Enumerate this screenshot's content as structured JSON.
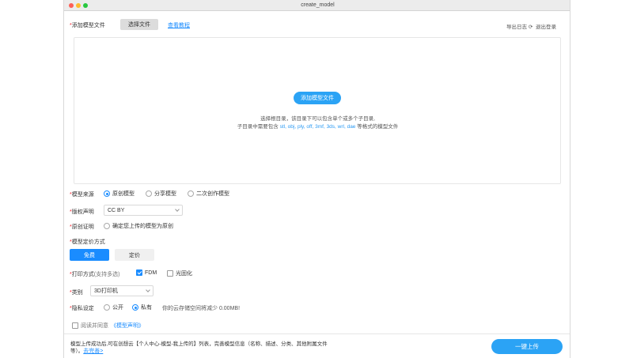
{
  "window": {
    "title": "create_model"
  },
  "header": {
    "add_file_label": "添加模型文件",
    "select_file_button": "选择文件",
    "tutorial_link": "查看教程",
    "export_log": "导出日志",
    "logout": "退出登录"
  },
  "dropzone": {
    "add_button": "添加模型文件",
    "hint_line1": "选择根目录，该目录下可以包含单个或多个子目录,",
    "hint_line2_prefix": "子目录中需要包含",
    "hint_formats": "stl, obj, ply, off, 3mf, 3ds, wrl, dae",
    "hint_line2_suffix": "等格式的模型文件"
  },
  "form": {
    "source": {
      "label": "模型来源",
      "options": [
        "原创模型",
        "分享模型",
        "二次创作模型"
      ],
      "selected": "原创模型"
    },
    "license": {
      "label": "版权声明",
      "value": "CC BY"
    },
    "original_proof": {
      "label": "原创证明",
      "option": "确定您上传的模型为原创"
    },
    "pricing": {
      "label": "模型定价方式",
      "options": [
        "免费",
        "定价"
      ],
      "selected": "免费"
    },
    "print_method": {
      "label": "打印方式",
      "note": "(支持多选)",
      "options": [
        {
          "label": "FDM",
          "checked": true
        },
        {
          "label": "光固化",
          "checked": false
        }
      ]
    },
    "category": {
      "label": "类别",
      "value": "3D打印机"
    },
    "privacy": {
      "label": "隐私设定",
      "options": [
        "公开",
        "私有"
      ],
      "selected": "私有",
      "note": "你的云存储空间将减少 0.00MB!"
    },
    "agreement": {
      "prefix": "阅读并同意",
      "link": "《模型声明》"
    }
  },
  "footer": {
    "text": "模型上传成功后,可在创想云【个人中心-模型-我上传的】列表，完善模型信息（名称、描述、分类、其他附属文件等）。",
    "link": "去完善>",
    "upload_button": "一键上传"
  },
  "colors": {
    "accent": "#1a8cff",
    "button_blue": "#2ba3f5",
    "required": "#f5222d"
  }
}
